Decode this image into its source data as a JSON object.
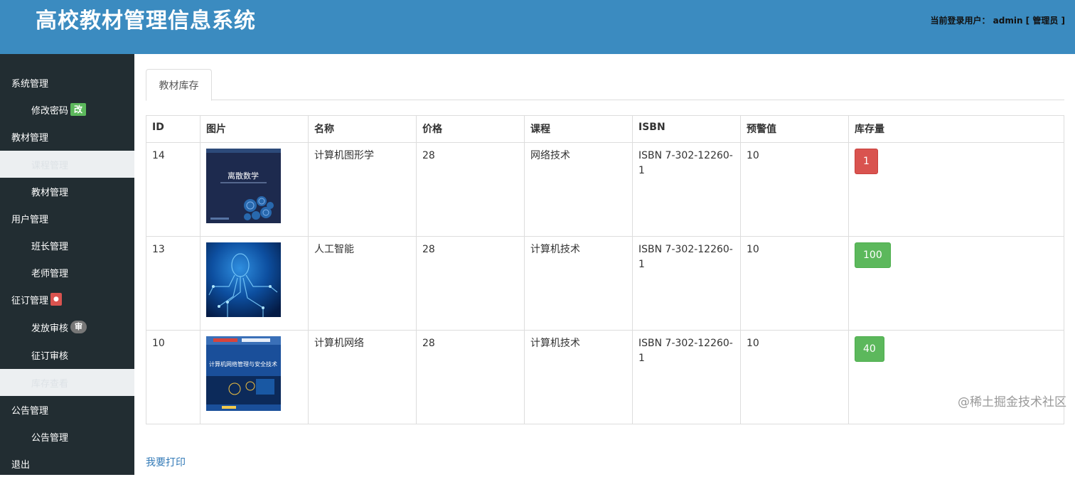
{
  "header": {
    "title": "高校教材管理信息系统",
    "user_info": "当前登录用户： admin [ 管理员 ]"
  },
  "sidebar": {
    "items": [
      {
        "label": "系统管理",
        "type": "group"
      },
      {
        "label": "修改密码",
        "type": "sub",
        "badge": "改"
      },
      {
        "label": "教材管理",
        "type": "group"
      },
      {
        "label": "课程管理",
        "type": "sub"
      },
      {
        "label": "教材管理",
        "type": "sub"
      },
      {
        "label": "用户管理",
        "type": "group"
      },
      {
        "label": "班长管理",
        "type": "sub"
      },
      {
        "label": "老师管理",
        "type": "sub"
      },
      {
        "label": "征订管理",
        "type": "group",
        "badge": "●"
      },
      {
        "label": "发放审核",
        "type": "sub",
        "badge": "审"
      },
      {
        "label": "征订审核",
        "type": "sub"
      },
      {
        "label": "库存查看",
        "type": "sub"
      },
      {
        "label": "公告管理",
        "type": "group"
      },
      {
        "label": "公告管理",
        "type": "sub"
      },
      {
        "label": "退出",
        "type": "group"
      }
    ]
  },
  "main": {
    "tab": "教材库存",
    "table": {
      "headers": [
        "ID",
        "图片",
        "名称",
        "价格",
        "课程",
        "ISBN",
        "预警值",
        "库存量"
      ],
      "rows": [
        {
          "id": "14",
          "cover": "离散数学",
          "name": "计算机图形学",
          "price": "28",
          "course": "网络技术",
          "isbn": "ISBN 7-302-12260-1",
          "warning": "10",
          "stock": "1"
        },
        {
          "id": "13",
          "cover": "",
          "name": "人工智能",
          "price": "28",
          "course": "计算机技术",
          "isbn": "ISBN 7-302-12260-1",
          "warning": "10",
          "stock": "100"
        },
        {
          "id": "10",
          "cover": "计算机网络管理与安全技术",
          "name": "计算机网络",
          "price": "28",
          "course": "计算机技术",
          "isbn": "ISBN 7-302-12260-1",
          "warning": "10",
          "stock": "40"
        }
      ]
    },
    "print_link": "我要打印"
  },
  "watermark": "@稀土掘金技术社区",
  "colors": {
    "header": "#3b8bc0",
    "sidebar": "#222d32",
    "danger": "#d9534f",
    "success": "#5cb85c",
    "link": "#337ab7"
  }
}
